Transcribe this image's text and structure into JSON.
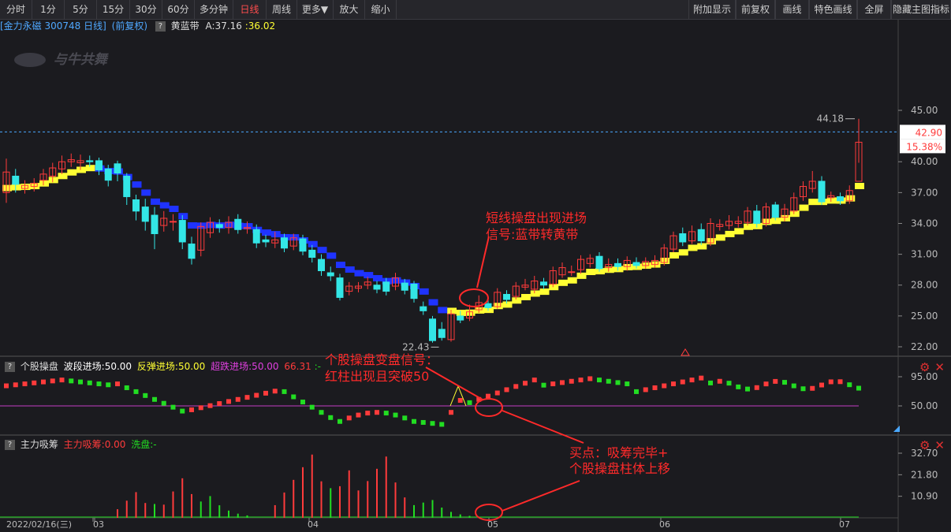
{
  "toolbar": {
    "left_buttons": [
      "分时",
      "1分",
      "5分",
      "15分",
      "30分",
      "60分",
      "多分钟",
      "日线",
      "周线",
      "更多▼",
      "放大",
      "缩小"
    ],
    "active_index": 7,
    "right_buttons": [
      "附加显示",
      "前复权",
      "画线",
      "特色画线",
      "全屏",
      "隐藏主图指标"
    ]
  },
  "main_info": {
    "stock": "[金力永磁 300748 日线]",
    "adjust": "(前复权)",
    "indicator_name": "黄蓝带",
    "value_a": "A:37.16",
    "value_b": ":36.02"
  },
  "logo_text": "与牛共舞",
  "price_axis": {
    "labels": [
      "45.00",
      "42.90",
      "15.38%",
      "40.00",
      "37.00",
      "34.00",
      "31.00",
      "28.00",
      "25.00",
      "22.00"
    ]
  },
  "markers": {
    "high": "44.18",
    "low": "22.43"
  },
  "annotations": {
    "signal1_line1": "短线操盘出现进场",
    "signal1_line2": "信号:蓝带转黄带",
    "signal2_line1": "个股操盘变盘信号：",
    "signal2_line2": "红柱出现且突破50",
    "buy_line1": "买点：吸筹完毕+",
    "buy_line2": "个股操盘柱体上移"
  },
  "panel2": {
    "name": "个股操盘",
    "l1": "波段进场:50.00",
    "l2": "反弹进场:50.00",
    "l3": "超跌进场:50.00",
    "v4": "66.31",
    "dash": ":-",
    "axis": [
      "95.00",
      "50.00"
    ]
  },
  "panel3": {
    "name": "主力吸筹",
    "l1": "主力吸筹:0.00",
    "l2": "洗盘:-",
    "axis": [
      "32.70",
      "21.80",
      "10.90"
    ]
  },
  "date_axis": [
    "2022/02/16(三)",
    "03",
    "04",
    "05",
    "06",
    "07"
  ],
  "colors": {
    "up": "#ff3b3b",
    "down": "#33e6e6",
    "yellow": "#ffff33",
    "blue": "#1f33ff",
    "green": "#22dd22",
    "magenta": "#c33cc3",
    "annotation": "#ff2a2a"
  },
  "chart_data": {
    "type": "candlestick",
    "candles": [
      {
        "o": 37.0,
        "c": 39.0,
        "h": 40.3,
        "l": 36.0
      },
      {
        "o": 38.6,
        "c": 37.8,
        "h": 39.3,
        "l": 37.0
      },
      {
        "o": 37.4,
        "c": 37.7,
        "h": 38.2,
        "l": 36.9
      },
      {
        "o": 37.6,
        "c": 37.9,
        "h": 38.4,
        "l": 37.1
      },
      {
        "o": 38.2,
        "c": 38.8,
        "h": 39.3,
        "l": 37.7
      },
      {
        "o": 38.6,
        "c": 39.4,
        "h": 39.9,
        "l": 38.0
      },
      {
        "o": 39.3,
        "c": 40.0,
        "h": 40.6,
        "l": 38.8
      },
      {
        "o": 40.0,
        "c": 40.2,
        "h": 40.8,
        "l": 39.5
      },
      {
        "o": 39.9,
        "c": 40.1,
        "h": 40.7,
        "l": 39.2
      },
      {
        "o": 40.1,
        "c": 40.0,
        "h": 40.6,
        "l": 39.5
      },
      {
        "o": 40.1,
        "c": 39.2,
        "h": 40.4,
        "l": 38.7
      },
      {
        "o": 39.3,
        "c": 38.2,
        "h": 39.7,
        "l": 37.6
      },
      {
        "o": 39.8,
        "c": 38.9,
        "h": 40.1,
        "l": 38.1
      },
      {
        "o": 38.6,
        "c": 36.6,
        "h": 38.9,
        "l": 35.8
      },
      {
        "o": 36.3,
        "c": 35.2,
        "h": 36.8,
        "l": 34.3
      },
      {
        "o": 35.6,
        "c": 34.2,
        "h": 36.4,
        "l": 33.3
      },
      {
        "o": 34.8,
        "c": 33.0,
        "h": 35.6,
        "l": 31.5
      },
      {
        "o": 33.8,
        "c": 34.5,
        "h": 35.2,
        "l": 33.2
      },
      {
        "o": 34.2,
        "c": 34.2,
        "h": 34.9,
        "l": 33.3
      },
      {
        "o": 34.3,
        "c": 32.2,
        "h": 34.8,
        "l": 31.5
      },
      {
        "o": 32.0,
        "c": 30.6,
        "h": 32.7,
        "l": 30.0
      },
      {
        "o": 31.4,
        "c": 33.7,
        "h": 34.1,
        "l": 30.8
      },
      {
        "o": 33.1,
        "c": 34.1,
        "h": 34.6,
        "l": 32.6
      },
      {
        "o": 33.9,
        "c": 33.6,
        "h": 34.4,
        "l": 33.1
      },
      {
        "o": 33.6,
        "c": 34.1,
        "h": 34.7,
        "l": 33.0
      },
      {
        "o": 34.4,
        "c": 33.4,
        "h": 34.9,
        "l": 33.0
      },
      {
        "o": 33.5,
        "c": 33.6,
        "h": 34.2,
        "l": 33.0
      },
      {
        "o": 33.4,
        "c": 32.1,
        "h": 33.9,
        "l": 31.6
      },
      {
        "o": 32.4,
        "c": 32.2,
        "h": 32.9,
        "l": 31.7
      },
      {
        "o": 32.1,
        "c": 32.4,
        "h": 33.2,
        "l": 31.6
      },
      {
        "o": 32.6,
        "c": 31.6,
        "h": 33.0,
        "l": 31.2
      },
      {
        "o": 31.8,
        "c": 32.6,
        "h": 33.0,
        "l": 31.4
      },
      {
        "o": 32.5,
        "c": 31.3,
        "h": 32.9,
        "l": 30.9
      },
      {
        "o": 31.4,
        "c": 30.7,
        "h": 31.9,
        "l": 30.2
      },
      {
        "o": 30.5,
        "c": 29.4,
        "h": 31.0,
        "l": 28.9
      },
      {
        "o": 29.2,
        "c": 28.9,
        "h": 29.8,
        "l": 28.4
      },
      {
        "o": 28.7,
        "c": 26.8,
        "h": 29.1,
        "l": 26.5
      },
      {
        "o": 27.4,
        "c": 27.9,
        "h": 28.3,
        "l": 27.0
      },
      {
        "o": 27.7,
        "c": 27.9,
        "h": 28.3,
        "l": 27.3
      },
      {
        "o": 28.0,
        "c": 28.3,
        "h": 28.8,
        "l": 27.6
      },
      {
        "o": 28.0,
        "c": 27.6,
        "h": 28.4,
        "l": 27.2
      },
      {
        "o": 28.3,
        "c": 27.4,
        "h": 28.7,
        "l": 27.0
      },
      {
        "o": 27.9,
        "c": 28.7,
        "h": 29.2,
        "l": 27.5
      },
      {
        "o": 28.2,
        "c": 27.5,
        "h": 28.6,
        "l": 27.1
      },
      {
        "o": 28.1,
        "c": 26.7,
        "h": 28.4,
        "l": 26.3
      },
      {
        "o": 25.9,
        "c": 25.5,
        "h": 26.4,
        "l": 25.1
      },
      {
        "o": 24.7,
        "c": 22.6,
        "h": 25.0,
        "l": 22.4
      },
      {
        "o": 23.7,
        "c": 22.9,
        "h": 24.4,
        "l": 22.6
      },
      {
        "o": 22.7,
        "c": 25.2,
        "h": 25.6,
        "l": 22.5
      },
      {
        "o": 25.0,
        "c": 24.6,
        "h": 25.5,
        "l": 24.3
      },
      {
        "o": 24.8,
        "c": 25.4,
        "h": 26.1,
        "l": 24.5
      },
      {
        "o": 25.6,
        "c": 26.3,
        "h": 27.0,
        "l": 25.3
      },
      {
        "o": 26.2,
        "c": 25.8,
        "h": 26.8,
        "l": 25.5
      },
      {
        "o": 25.9,
        "c": 27.3,
        "h": 27.7,
        "l": 25.7
      },
      {
        "o": 27.1,
        "c": 26.6,
        "h": 27.5,
        "l": 26.2
      },
      {
        "o": 26.9,
        "c": 27.9,
        "h": 28.3,
        "l": 26.6
      },
      {
        "o": 27.8,
        "c": 28.0,
        "h": 28.6,
        "l": 27.5
      },
      {
        "o": 27.6,
        "c": 28.4,
        "h": 28.9,
        "l": 27.2
      },
      {
        "o": 28.3,
        "c": 28.0,
        "h": 28.7,
        "l": 27.6
      },
      {
        "o": 28.1,
        "c": 29.4,
        "h": 29.8,
        "l": 27.8
      },
      {
        "o": 29.0,
        "c": 29.7,
        "h": 30.2,
        "l": 28.7
      },
      {
        "o": 29.3,
        "c": 29.3,
        "h": 29.9,
        "l": 28.9
      },
      {
        "o": 29.5,
        "c": 30.5,
        "h": 30.9,
        "l": 29.1
      },
      {
        "o": 30.1,
        "c": 30.6,
        "h": 31.0,
        "l": 29.7
      },
      {
        "o": 30.8,
        "c": 29.6,
        "h": 31.2,
        "l": 29.3
      },
      {
        "o": 29.7,
        "c": 30.0,
        "h": 30.6,
        "l": 29.3
      },
      {
        "o": 30.1,
        "c": 29.8,
        "h": 30.6,
        "l": 29.4
      },
      {
        "o": 29.8,
        "c": 30.4,
        "h": 30.8,
        "l": 29.4
      },
      {
        "o": 30.2,
        "c": 29.9,
        "h": 30.7,
        "l": 29.6
      },
      {
        "o": 29.9,
        "c": 30.3,
        "h": 30.7,
        "l": 29.6
      },
      {
        "o": 30.0,
        "c": 30.4,
        "h": 30.9,
        "l": 29.7
      },
      {
        "o": 30.2,
        "c": 31.6,
        "h": 32.0,
        "l": 29.9
      },
      {
        "o": 31.5,
        "c": 32.8,
        "h": 33.2,
        "l": 31.2
      },
      {
        "o": 33.0,
        "c": 32.2,
        "h": 33.6,
        "l": 31.8
      },
      {
        "o": 32.3,
        "c": 33.2,
        "h": 33.8,
        "l": 32.0
      },
      {
        "o": 33.4,
        "c": 32.3,
        "h": 34.0,
        "l": 31.9
      },
      {
        "o": 32.1,
        "c": 34.0,
        "h": 34.5,
        "l": 31.8
      },
      {
        "o": 33.7,
        "c": 33.9,
        "h": 34.4,
        "l": 33.3
      },
      {
        "o": 33.8,
        "c": 34.2,
        "h": 34.8,
        "l": 33.4
      },
      {
        "o": 34.0,
        "c": 34.2,
        "h": 34.7,
        "l": 33.6
      },
      {
        "o": 34.1,
        "c": 35.2,
        "h": 35.6,
        "l": 33.8
      },
      {
        "o": 35.2,
        "c": 34.0,
        "h": 35.8,
        "l": 33.6
      },
      {
        "o": 34.0,
        "c": 35.6,
        "h": 36.0,
        "l": 33.7
      },
      {
        "o": 35.8,
        "c": 34.6,
        "h": 36.1,
        "l": 34.3
      },
      {
        "o": 34.6,
        "c": 35.4,
        "h": 35.9,
        "l": 34.2
      },
      {
        "o": 35.2,
        "c": 36.5,
        "h": 37.0,
        "l": 34.9
      },
      {
        "o": 36.6,
        "c": 37.6,
        "h": 38.1,
        "l": 36.2
      },
      {
        "o": 37.4,
        "c": 38.1,
        "h": 39.1,
        "l": 37.0
      },
      {
        "o": 38.1,
        "c": 36.1,
        "h": 38.6,
        "l": 35.8
      },
      {
        "o": 36.5,
        "c": 36.7,
        "h": 37.1,
        "l": 36.1
      },
      {
        "o": 36.6,
        "c": 36.2,
        "h": 37.0,
        "l": 35.8
      },
      {
        "o": 36.2,
        "c": 37.2,
        "h": 37.7,
        "l": 35.9
      },
      {
        "o": 38.1,
        "c": 41.9,
        "h": 44.18,
        "l": 39.9
      }
    ]
  }
}
